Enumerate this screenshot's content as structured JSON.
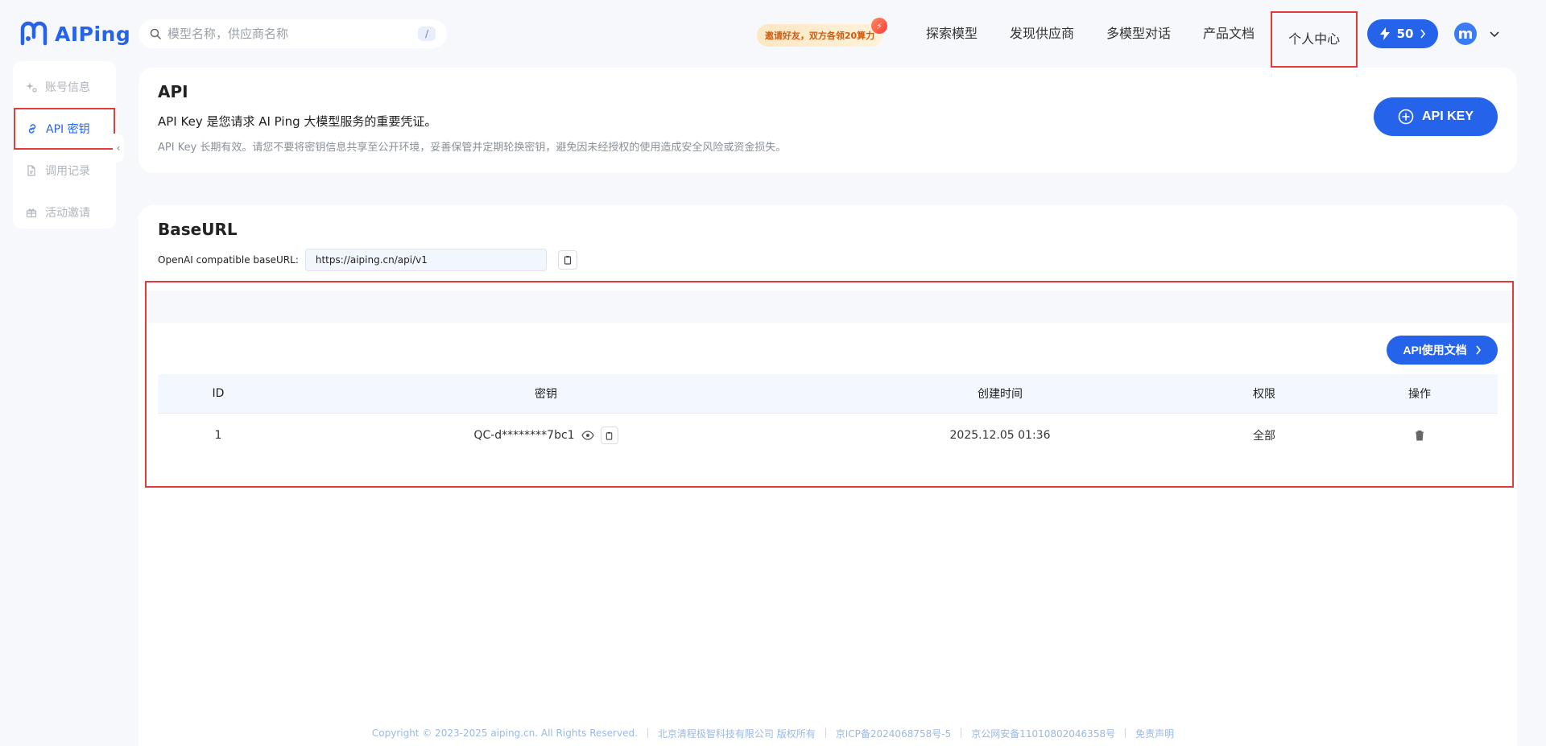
{
  "header": {
    "logo_text": "AIPing",
    "search": {
      "placeholder": "模型名称，供应商名称",
      "shortcut": "/"
    },
    "invite": {
      "text": "邀请好友，双方各领20算力"
    },
    "nav": [
      "探索模型",
      "发现供应商",
      "多模型对话",
      "产品文档",
      "个人中心"
    ],
    "points": "50",
    "avatar_letter": "m"
  },
  "sidebar": {
    "items": [
      {
        "label": "账号信息",
        "icon": "sparkle-icon"
      },
      {
        "label": "API 密钥",
        "icon": "key-link-icon"
      },
      {
        "label": "调用记录",
        "icon": "document-icon"
      },
      {
        "label": "活动邀请",
        "icon": "gift-icon"
      }
    ],
    "collapse_glyph": "‹"
  },
  "api_card": {
    "title": "API",
    "desc": "API Key 是您请求 AI Ping 大模型服务的重要凭证。",
    "note": "API Key 长期有效。请您不要将密钥信息共享至公开环境，妥善保管并定期轮换密钥，避免因未经授权的使用造成安全风险或资金损失。",
    "button": "API KEY"
  },
  "base_card": {
    "title": "BaseURL",
    "label": "OpenAI compatible baseURL:",
    "url": "https://aiping.cn/api/v1",
    "doc_button": "API使用文档"
  },
  "table": {
    "headers": {
      "id": "ID",
      "key": "密钥",
      "time": "创建时间",
      "perm": "权限",
      "op": "操作"
    },
    "rows": [
      {
        "id": "1",
        "key": "QC-d********7bc1",
        "time": "2025.12.05 01:36",
        "perm": "全部"
      }
    ]
  },
  "footer": {
    "items": [
      "Copyright © 2023-2025 aiping.cn. All Rights Reserved.",
      "北京清程极智科技有限公司 版权所有",
      "京ICP备2024068758号-5",
      "京公网安备11010802046358号",
      "免责声明"
    ]
  }
}
